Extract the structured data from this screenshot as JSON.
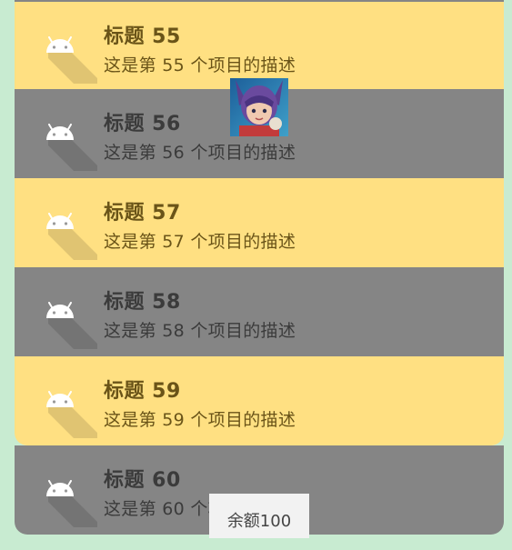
{
  "items": [
    {
      "title": "标题 55",
      "desc": "这是第 55 个项目的描述"
    },
    {
      "title": "标题 56",
      "desc": "这是第 56 个项目的描述"
    },
    {
      "title": "标题 57",
      "desc": "这是第 57 个项目的描述"
    },
    {
      "title": "标题 58",
      "desc": "这是第 58 个项目的描述"
    },
    {
      "title": "标题 59",
      "desc": "这是第 59 个项目的描述"
    },
    {
      "title": "标题 60",
      "desc": "这是第 60 个项目的描述"
    }
  ],
  "toast": {
    "text": "余额100"
  },
  "colors": {
    "yellow_row": "#ffe082",
    "gray_row": "#858585",
    "background": "#c8ebd1"
  },
  "icons": {
    "row_icon": "android-icon",
    "overlay": "avatar-image"
  }
}
